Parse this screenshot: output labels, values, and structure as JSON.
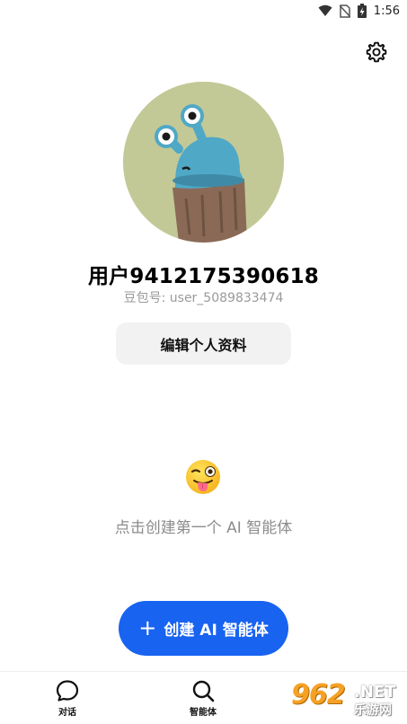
{
  "status_bar": {
    "time": "1:56",
    "icons": [
      "wifi-icon",
      "no-sim-icon",
      "battery-charging-icon"
    ]
  },
  "header": {
    "settings_icon": "gear-icon"
  },
  "profile": {
    "username": "用户9412175390618",
    "user_id": "豆包号: user_5089833474",
    "edit_button": "编辑个人资料"
  },
  "empty_state": {
    "emoji": "winking-face-tongue",
    "text": "点击创建第一个 AI 智能体"
  },
  "create_button": {
    "plus": "+",
    "label": "创建 AI 智能体"
  },
  "tab_bar": {
    "tabs": [
      {
        "label": "对话",
        "icon": "chat-bubble-icon"
      },
      {
        "label": "智能体",
        "icon": "search-icon"
      }
    ]
  },
  "watermark": {
    "number": "962",
    "net": ".NET",
    "chinese": "乐游网"
  },
  "colors": {
    "primary": "#1863f0",
    "avatar_bg": "#c3c996",
    "muted_text": "#8c8c8c"
  }
}
